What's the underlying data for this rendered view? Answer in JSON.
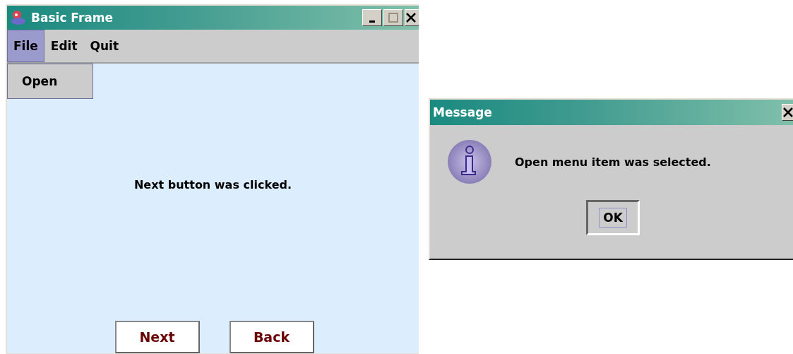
{
  "frame": {
    "title": "Basic Frame",
    "menus": [
      {
        "label": "File",
        "selected": true
      },
      {
        "label": "Edit",
        "selected": false
      },
      {
        "label": "Quit",
        "selected": false
      }
    ],
    "open_menu": {
      "items": [
        "Open"
      ]
    },
    "status_text": "Next button was clicked.",
    "buttons": [
      {
        "label": "Next"
      },
      {
        "label": "Back"
      }
    ]
  },
  "dialog": {
    "title": "Message",
    "message": "Open menu item was selected.",
    "button": {
      "label": "OK",
      "focused": true
    }
  }
}
